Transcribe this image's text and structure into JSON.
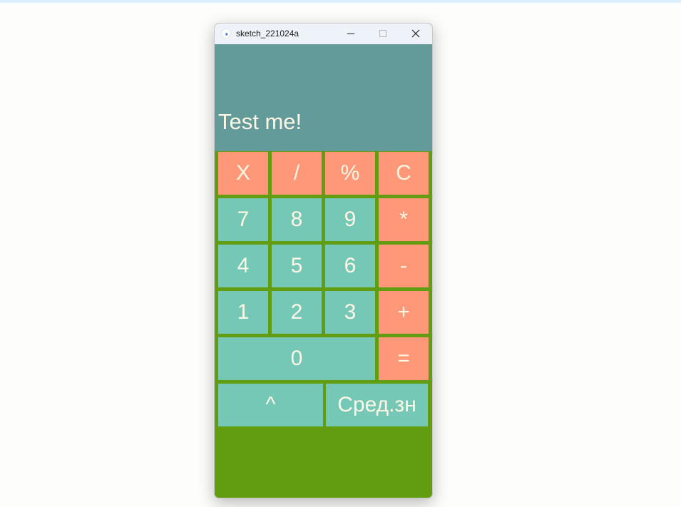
{
  "window": {
    "title": "sketch_221024a",
    "icons": {
      "app": "processing-play-icon",
      "minimize": "minimize-icon",
      "maximize": "maximize-icon",
      "close": "close-icon"
    }
  },
  "display": {
    "text": "Test me!"
  },
  "keys": {
    "clear_x": "X",
    "divide": "/",
    "percent": "%",
    "clear_all": "C",
    "seven": "7",
    "eight": "8",
    "nine": "9",
    "multiply": "*",
    "four": "4",
    "five": "5",
    "six": "6",
    "subtract": "-",
    "one": "1",
    "two": "2",
    "three": "3",
    "add": "+",
    "zero": "0",
    "equals": "=",
    "power": "^",
    "average": "Сред.зн"
  },
  "colors": {
    "window_background": "#629c10",
    "display_background": "#629b9a",
    "operator_key": "#ff9878",
    "digit_key": "#76c8b6",
    "key_text": "#fff7e6"
  }
}
